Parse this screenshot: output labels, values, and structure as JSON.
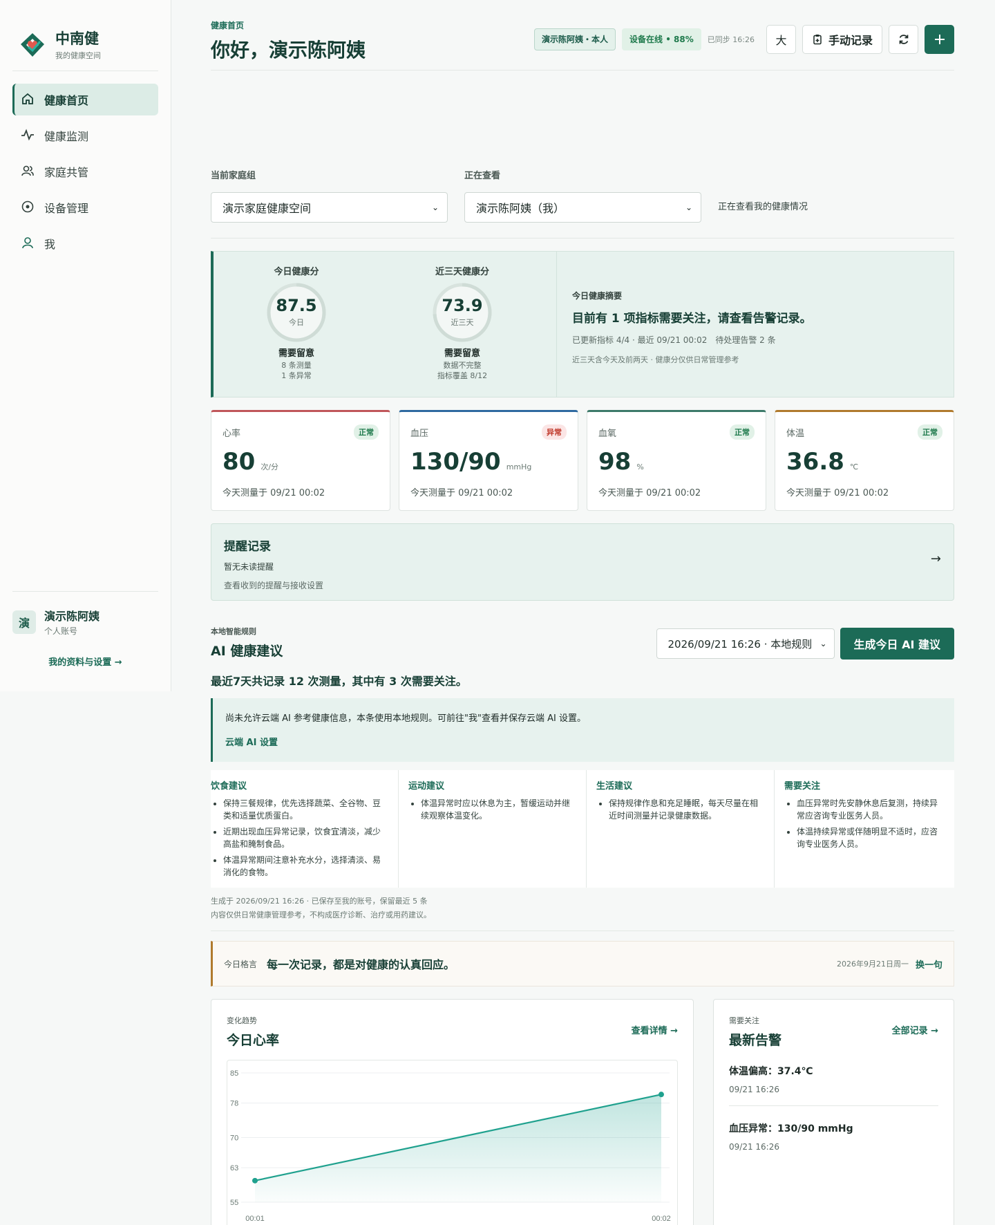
{
  "brand": {
    "name": "中南健",
    "subtitle": "我的健康空间"
  },
  "nav": [
    {
      "label": "健康首页",
      "icon": "home-icon",
      "active": true
    },
    {
      "label": "健康监测",
      "icon": "pulse-icon",
      "active": false
    },
    {
      "label": "家庭共管",
      "icon": "family-icon",
      "active": false
    },
    {
      "label": "设备管理",
      "icon": "device-icon",
      "active": false
    },
    {
      "label": "我",
      "icon": "user-icon",
      "active": false
    }
  ],
  "user": {
    "avatar": "演",
    "name": "演示陈阿姨",
    "role": "个人账号",
    "profile_link": "我的资料与设置 →"
  },
  "header": {
    "breadcrumb": "健康首页",
    "title": "你好，演示陈阿姨",
    "identity_pill": "演示陈阿姨・本人",
    "device_pill": "设备在线 • 88%",
    "synced": "已同步 16:26",
    "font_button": "大",
    "record_button": "手动记录"
  },
  "selectors": {
    "family_label": "当前家庭组",
    "family_value": "演示家庭健康空间",
    "viewing_label": "正在查看",
    "viewing_value": "演示陈阿姨（我）",
    "viewing_note": "正在查看我的健康情况"
  },
  "scores": {
    "today": {
      "heading": "今日健康分",
      "value": "87.5",
      "caption": "今日",
      "status": "需要留意",
      "meta1": "8 条测量",
      "meta2": "1 条异常",
      "fraction": 0.875
    },
    "three_day": {
      "heading": "近三天健康分",
      "value": "73.9",
      "caption": "近三天",
      "status": "需要留意",
      "meta1": "数据不完整",
      "meta2": "指标覆盖 8/12",
      "fraction": 0.739
    },
    "summary": {
      "kicker": "今日健康摘要",
      "title": "目前有 1 项指标需要关注，请查看告警记录。",
      "meta": "已更新指标 4/4 · 最近 09/21 00:02　待处理告警 2 条",
      "note": "近三天含今天及前两天 · 健康分仅供日常管理参考"
    }
  },
  "metrics": [
    {
      "name": "心率",
      "badge": "正常",
      "value": "80",
      "unit": "次/分",
      "time": "今天测量于 09/21 00:02",
      "accent": "#c0565a",
      "abnormal": false
    },
    {
      "name": "血压",
      "badge": "异常",
      "value": "130/90",
      "unit": "mmHg",
      "time": "今天测量于 09/21 00:02",
      "accent": "#2f6aa0",
      "abnormal": true
    },
    {
      "name": "血氧",
      "badge": "正常",
      "value": "98",
      "unit": "%",
      "time": "今天测量于 09/21 00:02",
      "accent": "#3d7a6a",
      "abnormal": false
    },
    {
      "name": "体温",
      "badge": "正常",
      "value": "36.8",
      "unit": "℃",
      "time": "今天测量于 09/21 00:02",
      "accent": "#b07a2d",
      "abnormal": false
    }
  ],
  "reminder": {
    "title": "提醒记录",
    "subtitle": "暂无未读提醒",
    "desc": "查看收到的提醒与接收设置",
    "arrow": "→"
  },
  "ai": {
    "kicker": "本地智能规则",
    "title": "AI 健康建议",
    "date_select": "2026/09/21 16:26 · 本地规则",
    "generate_button": "生成今日 AI 建议",
    "stat": "最近7天共记录 12 次测量，其中有 3 次需要关注。",
    "cloud_note": "尚未允许云端 AI 参考健康信息，本条使用本地规则。可前往\"我\"查看并保存云端 AI 设置。",
    "cloud_link": "云端 AI 设置",
    "columns": [
      {
        "title": "饮食建议",
        "items": [
          "保持三餐规律，优先选择蔬菜、全谷物、豆类和适量优质蛋白。",
          "近期出现血压异常记录，饮食宜清淡，减少高盐和腌制食品。",
          "体温异常期间注意补充水分，选择清淡、易消化的食物。"
        ]
      },
      {
        "title": "运动建议",
        "items": [
          "体温异常时应以休息为主，暂缓运动并继续观察体温变化。"
        ]
      },
      {
        "title": "生活建议",
        "items": [
          "保持规律作息和充足睡眠，每天尽量在相近时间测量并记录健康数据。"
        ]
      },
      {
        "title": "需要关注",
        "items": [
          "血压异常时先安静休息后复测，持续异常应咨询专业医务人员。",
          "体温持续异常或伴随明显不适时，应咨询专业医务人员。"
        ]
      }
    ],
    "foot1": "生成于 2026/09/21 16:26 · 已保存至我的账号，保留最近 5 条",
    "foot2": "内容仅供日常健康管理参考，不构成医疗诊断、治疗或用药建议。"
  },
  "quote": {
    "label": "今日格言",
    "text": "每一次记录，都是对健康的认真回应。",
    "date": "2026年9月21日周一",
    "button": "换一句"
  },
  "trend": {
    "kicker": "变化趋势",
    "title": "今日心率",
    "link": "查看详情 →"
  },
  "alerts": {
    "kicker": "需要关注",
    "title": "最新告警",
    "link": "全部记录 →",
    "items": [
      {
        "title": "体温偏高：37.4℃",
        "time": "09/21 16:26"
      },
      {
        "title": "血压异常：130/90 mmHg",
        "time": "09/21 16:26"
      }
    ]
  },
  "colors": {
    "accent": "#1c6b57",
    "line": "#1fa18e",
    "warn": "#c0392b"
  },
  "chart_data": {
    "type": "area",
    "title": "今日心率",
    "x": [
      "00:01",
      "00:02"
    ],
    "series": [
      {
        "values": [
          60,
          80
        ]
      }
    ],
    "yticks": [
      55,
      63,
      70,
      78,
      85
    ],
    "ylim": [
      55,
      85
    ],
    "grid": true
  }
}
